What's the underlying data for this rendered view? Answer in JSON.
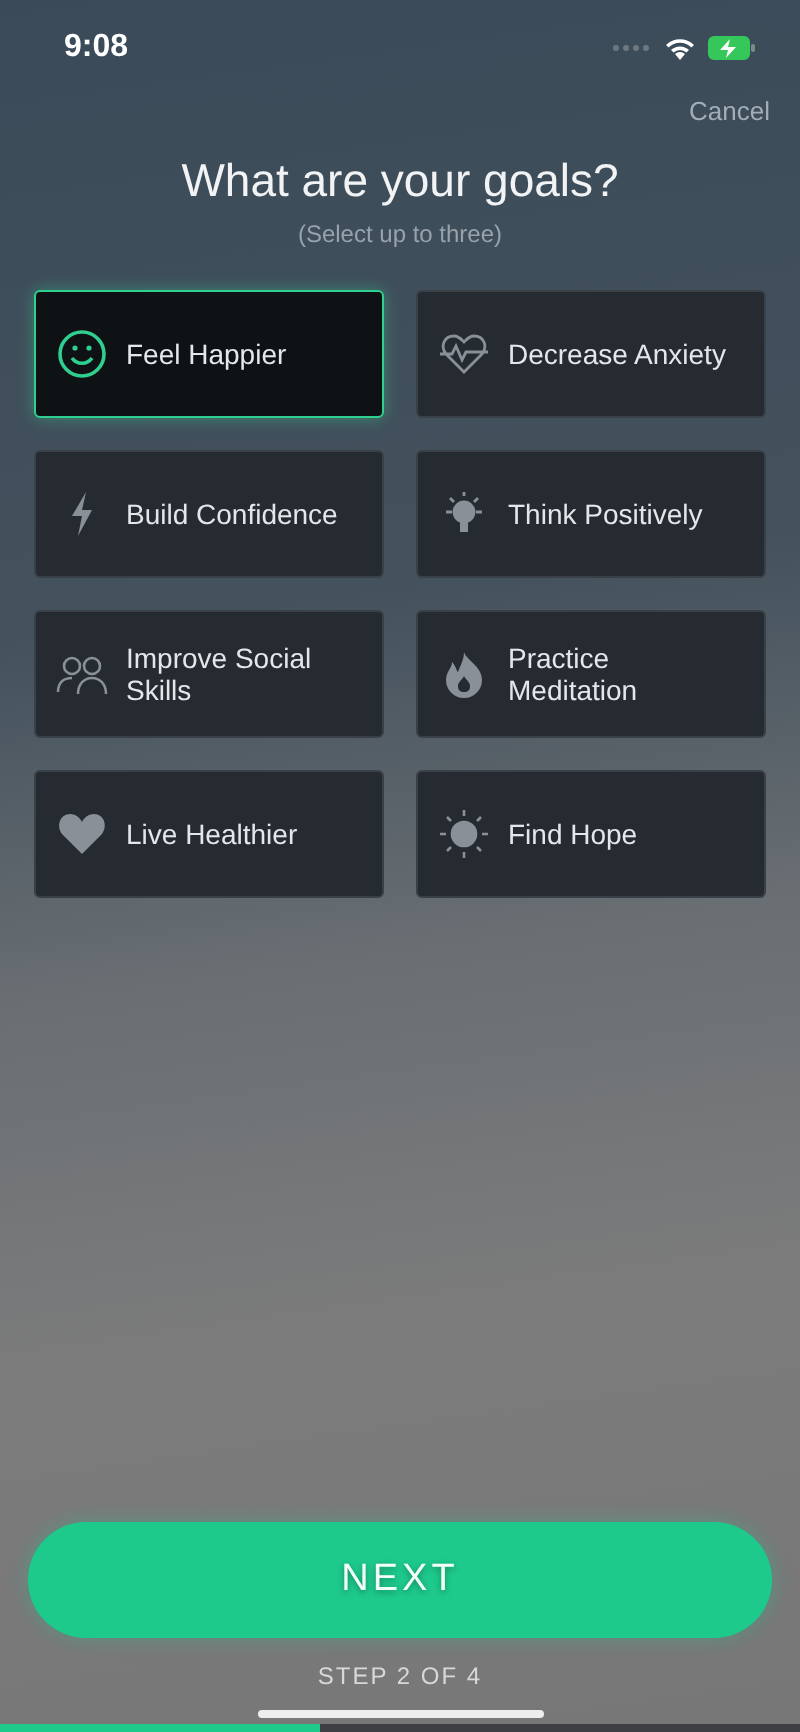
{
  "status_bar": {
    "time": "9:08"
  },
  "cancel": "Cancel",
  "title": "What are your goals?",
  "subtitle": "(Select up to three)",
  "goals": [
    {
      "label": "Feel Happier",
      "selected": true
    },
    {
      "label": "Decrease Anxiety",
      "selected": false
    },
    {
      "label": "Build Confidence",
      "selected": false
    },
    {
      "label": "Think Positively",
      "selected": false
    },
    {
      "label": "Improve Social Skills",
      "selected": false
    },
    {
      "label": "Practice Meditation",
      "selected": false
    },
    {
      "label": "Live Healthier",
      "selected": false
    },
    {
      "label": "Find Hope",
      "selected": false
    }
  ],
  "next_button": "NEXT",
  "step": "STEP 2 OF 4",
  "progress": {
    "level": 0.4
  }
}
